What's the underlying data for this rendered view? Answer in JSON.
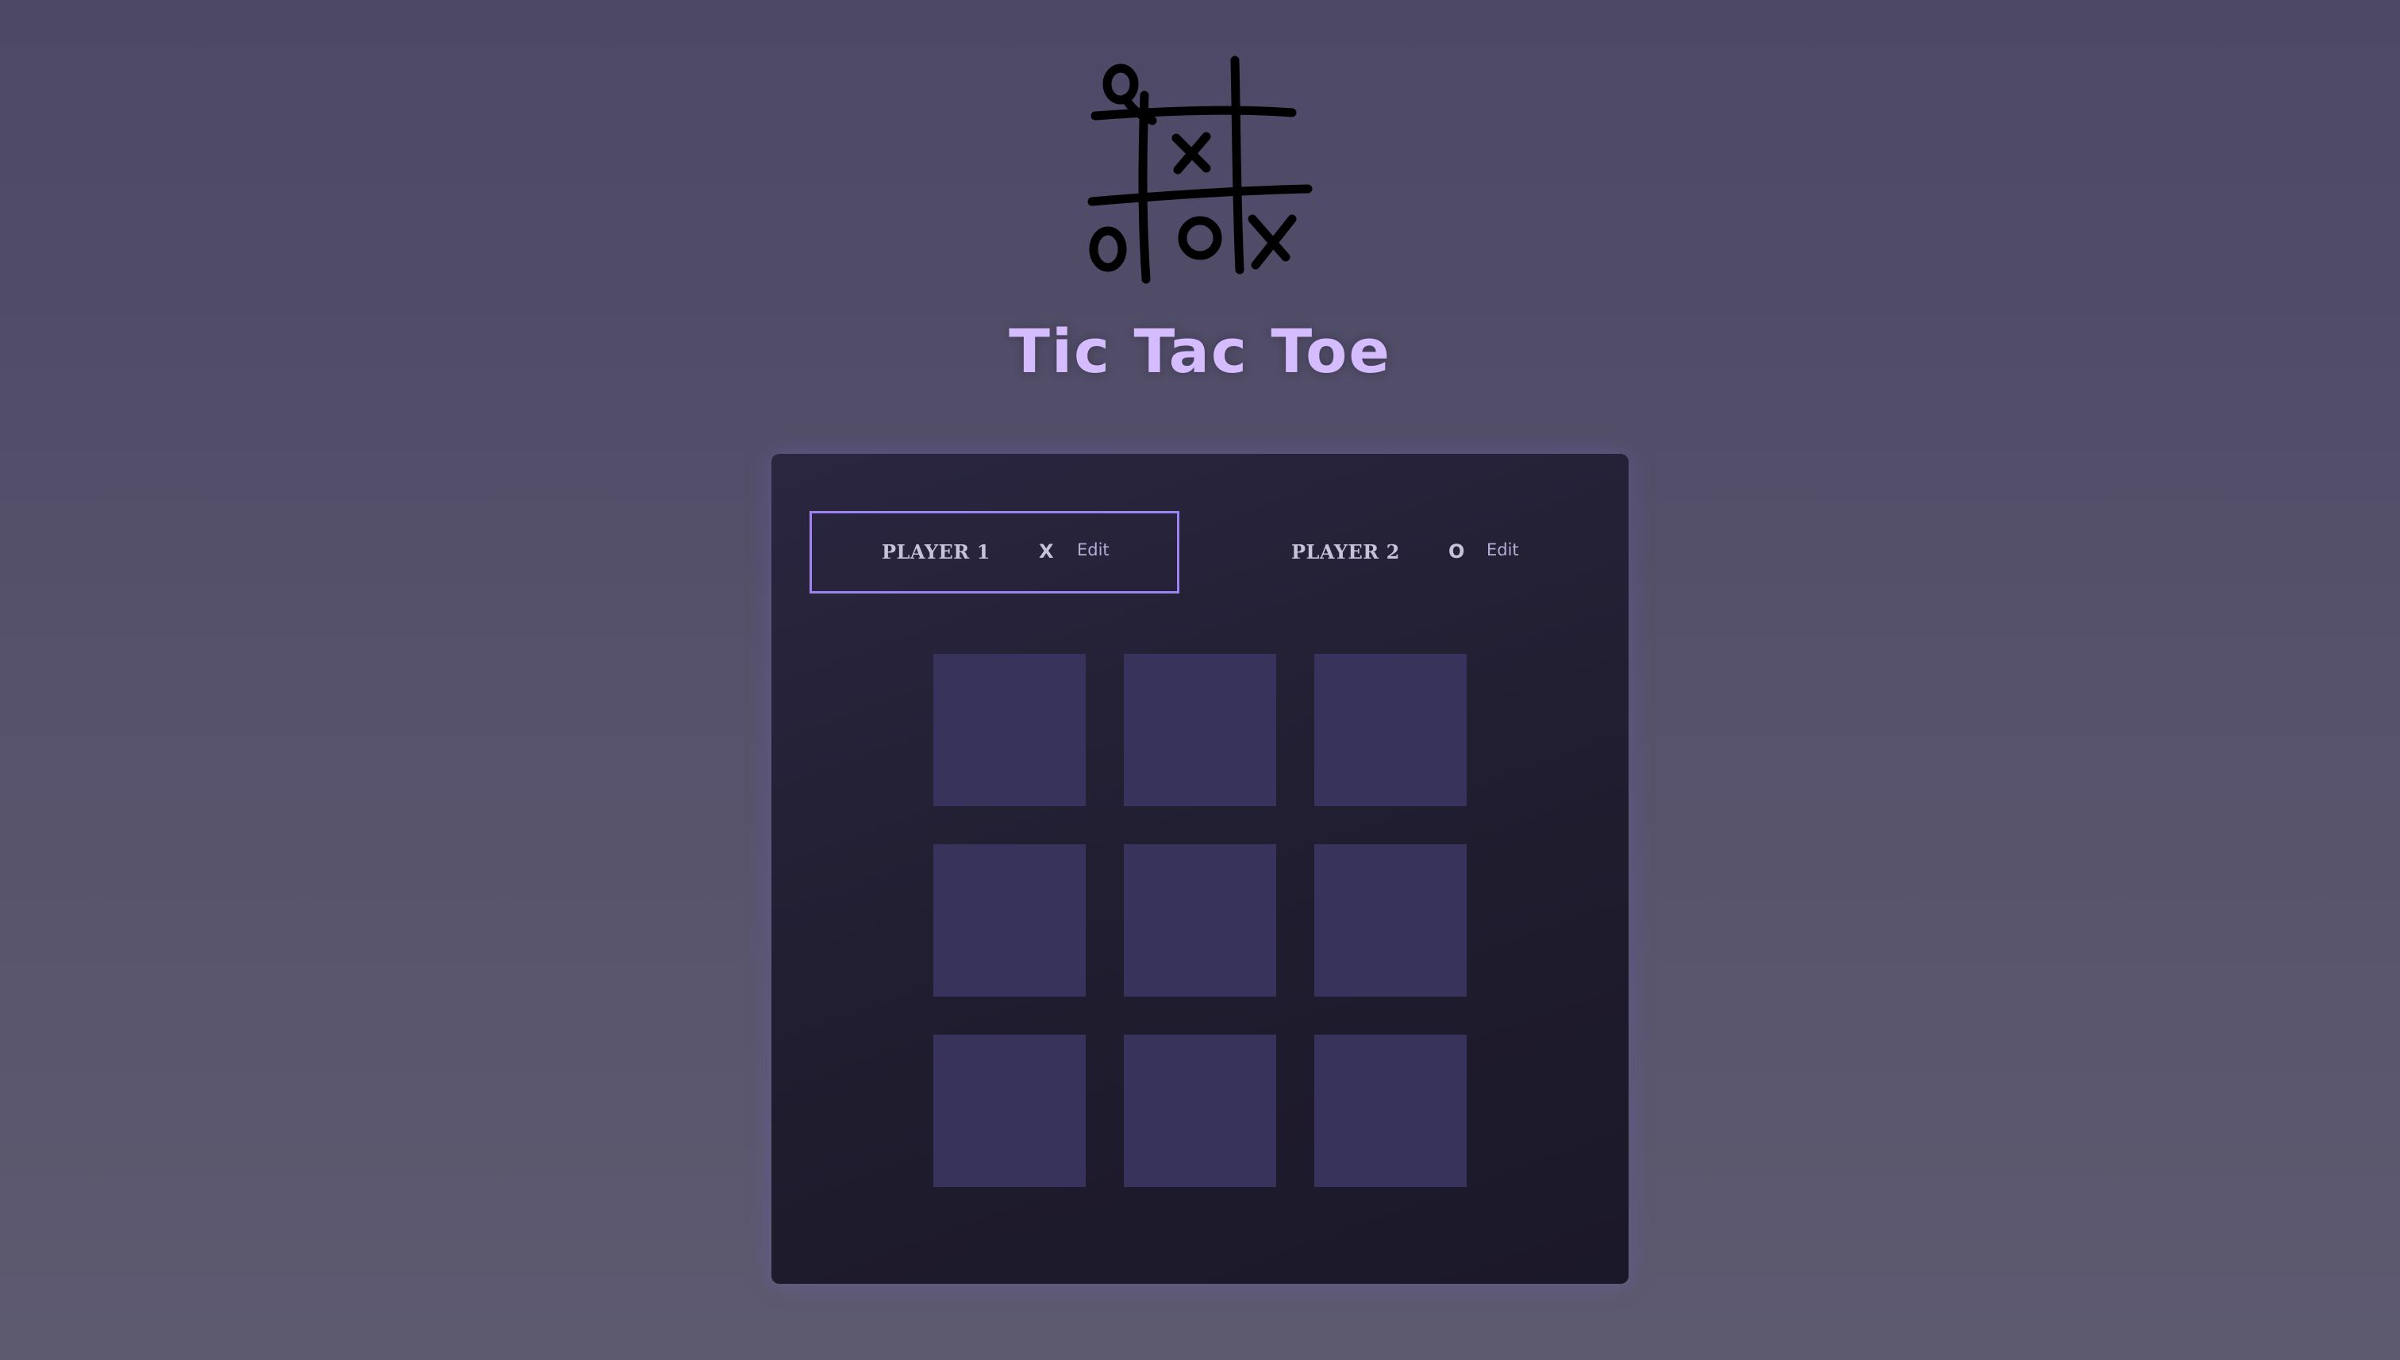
{
  "header": {
    "logo_icon": "tic-tac-toe-doodle-icon",
    "title": "Tic Tac Toe"
  },
  "players": [
    {
      "name": "PLAYER 1",
      "symbol": "X",
      "edit_label": "Edit",
      "active": true
    },
    {
      "name": "PLAYER 2",
      "symbol": "O",
      "edit_label": "Edit",
      "active": false
    }
  ],
  "board": {
    "cells": [
      "",
      "",
      "",
      "",
      "",
      "",
      "",
      "",
      ""
    ]
  },
  "colors": {
    "accent": "#d4bcff",
    "active_border": "#9d83ef",
    "cell": "#38335a",
    "panel": "#231f33"
  }
}
